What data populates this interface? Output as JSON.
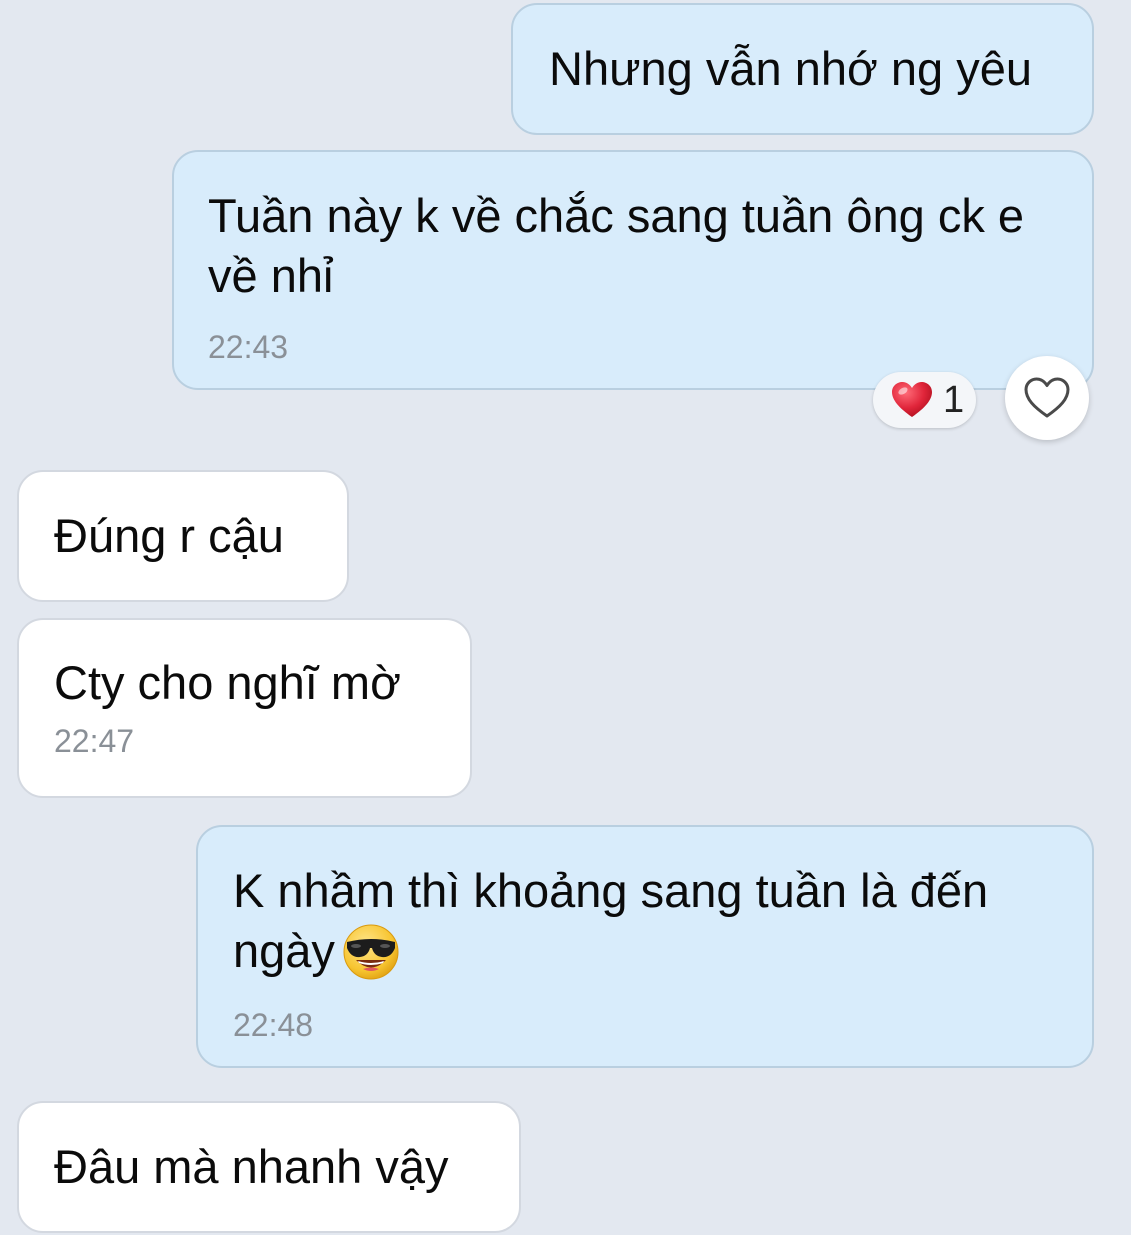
{
  "theme": {
    "background": "#e3e8f0",
    "sent_bubble": "#d8ecfb",
    "received_bubble": "#ffffff",
    "reaction_heart": "#e0253a"
  },
  "messages": [
    {
      "direction": "sent",
      "text": "Nhưng vẫn nhớ ng yêu",
      "time": ""
    },
    {
      "direction": "sent",
      "text": "Tuần này k về chắc sang tuần ông ck e về nhỉ",
      "time": "22:43"
    },
    {
      "direction": "received",
      "text": "Đúng r cậu",
      "time": ""
    },
    {
      "direction": "received",
      "text": "Cty cho nghĩ mờ",
      "time": "22:47"
    },
    {
      "direction": "sent",
      "text": "K nhầm thì khoảng sang tuần là đến ngày",
      "emoji": "sunglasses-emoji",
      "time": "22:48"
    },
    {
      "direction": "received",
      "text": "Đâu mà nhanh vậy",
      "time": ""
    }
  ],
  "reactions": {
    "icon": "red-heart-emoji",
    "count": "1",
    "add_reaction_icon": "heart-outline-icon"
  }
}
